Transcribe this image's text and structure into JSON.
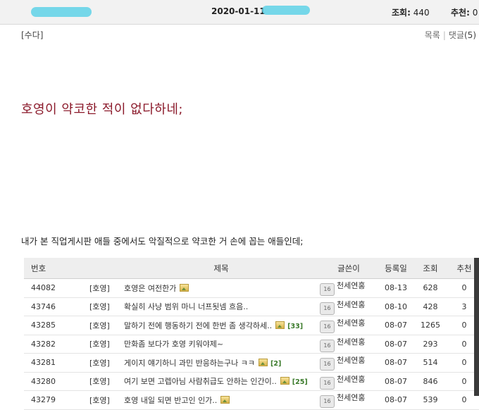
{
  "header": {
    "date": "2020-01-11",
    "views_label": "조회:",
    "views_value": "440",
    "recs_label": "추천:",
    "recs_value": "0"
  },
  "post": {
    "category": "[수다]",
    "list_link": "목록",
    "comments_link": "댓글",
    "comments_count": "(5)",
    "headline": "호영이 약코한 적이 없다하네;",
    "body": "내가 본 직업게시판 애들 중에서도 악질적으로 약코한 거 손에 꼽는 애들인데;"
  },
  "table": {
    "headers": {
      "no": "번호",
      "title": "제목",
      "writer": "글쓴이",
      "date": "등록일",
      "views": "조회",
      "rec": "추천"
    },
    "rows": [
      {
        "no": "44082",
        "head": "[호영]",
        "title": "호영은 여전한가",
        "img": true,
        "comments": "",
        "level": "16",
        "writer": "천세연홍",
        "date": "08-13",
        "views": "628",
        "rec": "0"
      },
      {
        "no": "43746",
        "head": "[호영]",
        "title": "확실히 사냥 범위 마니 너프됫넴 흐음..",
        "img": false,
        "comments": "",
        "level": "16",
        "writer": "천세연홍",
        "date": "08-10",
        "views": "428",
        "rec": "3"
      },
      {
        "no": "43285",
        "head": "[호영]",
        "title": "말하기 전에 행동하기 전에 한번 좀 생각하세..",
        "img": true,
        "comments": "[33]",
        "level": "16",
        "writer": "천세연홍",
        "date": "08-07",
        "views": "1265",
        "rec": "0"
      },
      {
        "no": "43282",
        "head": "[호영]",
        "title": "만화좀 보다가 호영 키워야제~",
        "img": false,
        "comments": "",
        "level": "16",
        "writer": "천세연홍",
        "date": "08-07",
        "views": "293",
        "rec": "0"
      },
      {
        "no": "43281",
        "head": "[호영]",
        "title": "게이지 얘기하니 과민 반응하는구나 ㅋㅋ",
        "img": true,
        "comments": "[2]",
        "level": "16",
        "writer": "천세연홍",
        "date": "08-07",
        "views": "514",
        "rec": "0"
      },
      {
        "no": "43280",
        "head": "[호영]",
        "title": "여기 보면 고렙아님 사람취급도 안하는 인간이..",
        "img": true,
        "comments": "[25]",
        "level": "16",
        "writer": "천세연홍",
        "date": "08-07",
        "views": "846",
        "rec": "0"
      },
      {
        "no": "43279",
        "head": "[호영]",
        "title": "호영 내일 되면 반고인 인가..",
        "img": true,
        "comments": "",
        "level": "16",
        "writer": "천세연홍",
        "date": "08-07",
        "views": "539",
        "rec": "0"
      }
    ]
  }
}
